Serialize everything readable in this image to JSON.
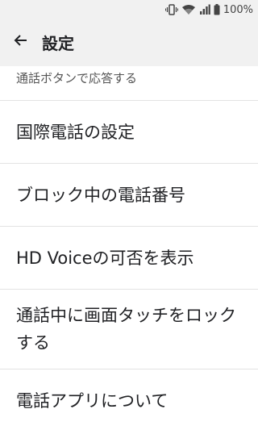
{
  "status_bar": {
    "battery": "100%",
    "icons": [
      "vibrate-icon",
      "wifi-icon",
      "signal-icon",
      "battery-icon"
    ]
  },
  "app_bar": {
    "title": "設定",
    "back_icon": "arrow-left-icon"
  },
  "settings": {
    "partial_item": "通話ボタンで応答する",
    "items": [
      {
        "label": "国際電話の設定"
      },
      {
        "label": "ブロック中の電話番号"
      },
      {
        "label": "HD Voiceの可否を表示"
      },
      {
        "label": "通話中に画面タッチをロックする"
      },
      {
        "label": "電話アプリについて"
      }
    ]
  }
}
